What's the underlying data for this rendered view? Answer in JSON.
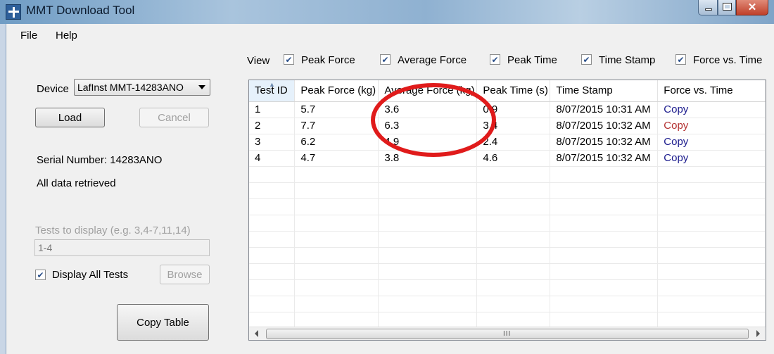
{
  "window": {
    "title": "MMT Download Tool",
    "close_glyph": "✕"
  },
  "menu": {
    "file": "File",
    "help": "Help"
  },
  "left_panel": {
    "device_label": "Device",
    "device_selected": "LafInst MMT-14283ANO",
    "load_button": "Load",
    "cancel_button": "Cancel",
    "serial_number": "Serial Number: 14283ANO",
    "status": "All data retrieved",
    "tests_to_display_label": "Tests to display (e.g. 3,4-7,11,14)",
    "tests_to_display_value": "1-4",
    "display_all_label": "Display All Tests",
    "display_all_checked": true,
    "browse_button": "Browse",
    "copy_table_button": "Copy Table"
  },
  "view": {
    "label": "View",
    "options": [
      {
        "label": "Peak Force",
        "checked": true
      },
      {
        "label": "Average Force",
        "checked": true
      },
      {
        "label": "Peak Time",
        "checked": true
      },
      {
        "label": "Time Stamp",
        "checked": true
      },
      {
        "label": "Force vs. Time",
        "checked": true
      }
    ]
  },
  "table": {
    "headers": [
      "Test ID",
      "Peak Force (kg)",
      "Average Force (kg)",
      "Peak Time (s)",
      "Time Stamp",
      "Force vs. Time"
    ],
    "rows": [
      [
        "1",
        "5.7",
        "3.6",
        "0.9",
        "8/07/2015 10:31 AM",
        "Copy"
      ],
      [
        "2",
        "7.7",
        "6.3",
        "3.4",
        "8/07/2015 10:32 AM",
        "Copy"
      ],
      [
        "3",
        "6.2",
        "4.9",
        "2.4",
        "8/07/2015 10:32 AM",
        "Copy"
      ],
      [
        "4",
        "4.7",
        "3.8",
        "4.6",
        "8/07/2015 10:32 AM",
        "Copy"
      ]
    ],
    "scroll_grip": "III"
  },
  "colors": {
    "annotation": "#e01b1b",
    "link": "#1a1a8c",
    "visited_link": "#b33030"
  }
}
